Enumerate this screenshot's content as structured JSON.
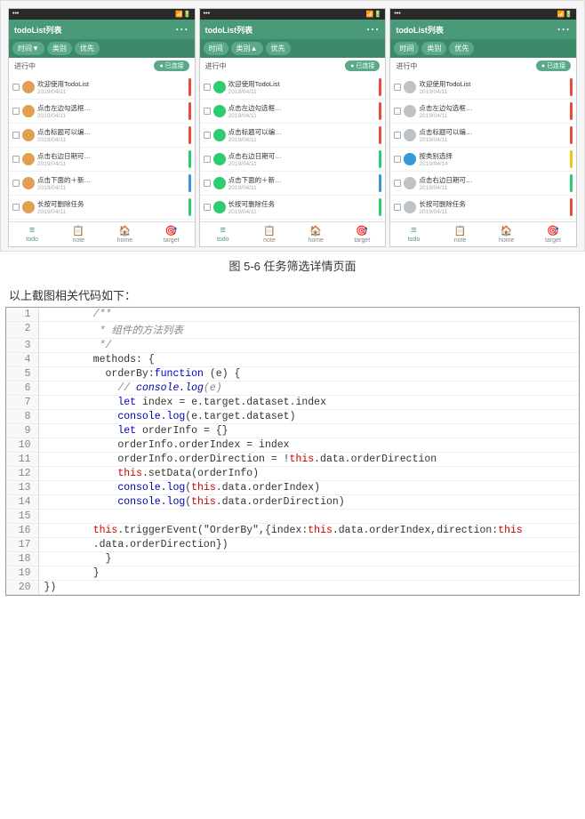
{
  "caption": "图 5-6  任务筛选详情页面",
  "codeIntro": "以上截图相关代码如下：",
  "screens": [
    {
      "titleBarText": "todoList列表",
      "statusInProgress": "进行中",
      "connectedBadge": "● 已连接",
      "filterBtns": [
        "时间▼",
        "类别",
        "优先"
      ],
      "items": [
        {
          "color": "#e0a050",
          "text": "欢迎使用TodoList",
          "date": "2019/04/11",
          "indicator": "#e74c3c"
        },
        {
          "color": "#e0a050",
          "text": "点击左边勾选框…",
          "date": "2019/04/11",
          "indicator": "#e74c3c"
        },
        {
          "color": "#e0a050",
          "text": "点击标题可以编…",
          "date": "2019/04/11",
          "indicator": "#e74c3c"
        },
        {
          "color": "#e0a050",
          "text": "点击右边日期可…",
          "date": "2019/04/11",
          "indicator": "#2ecc71"
        },
        {
          "color": "#e0a050",
          "text": "点击下面的＋新…",
          "date": "2019/04/11",
          "indicator": "#3498db"
        },
        {
          "color": "#e0a050",
          "text": "长按可删除任务",
          "date": "2019/04/11",
          "indicator": "#2ecc71"
        }
      ]
    },
    {
      "titleBarText": "todoList列表",
      "statusInProgress": "进行中",
      "connectedBadge": "● 已连接",
      "filterBtns": [
        "时间",
        "类别▲",
        "优先"
      ],
      "items": [
        {
          "color": "#2ecc71",
          "text": "欢迎使用TodoList",
          "date": "2019/04/11",
          "indicator": "#e74c3c"
        },
        {
          "color": "#2ecc71",
          "text": "点击左边勾选框…",
          "date": "2019/04/11",
          "indicator": "#e74c3c"
        },
        {
          "color": "#2ecc71",
          "text": "点击标题可以编…",
          "date": "2019/04/11",
          "indicator": "#e74c3c"
        },
        {
          "color": "#2ecc71",
          "text": "点击右边日期可…",
          "date": "2019/04/11",
          "indicator": "#2ecc71"
        },
        {
          "color": "#2ecc71",
          "text": "点击下面的＋新…",
          "date": "2019/04/11",
          "indicator": "#3498db"
        },
        {
          "color": "#2ecc71",
          "text": "长按可删除任务",
          "date": "2019/04/11",
          "indicator": "#2ecc71"
        }
      ]
    },
    {
      "titleBarText": "todoList列表",
      "statusInProgress": "进行中",
      "connectedBadge": "● 已连接",
      "filterBtns": [
        "时间",
        "类别",
        "优先"
      ],
      "items": [
        {
          "color": "#bdc3c7",
          "text": "欢迎使用TodoList",
          "date": "2019/04/11",
          "indicator": "#e74c3c"
        },
        {
          "color": "#bdc3c7",
          "text": "点击左边勾选框…",
          "date": "2019/04/11",
          "indicator": "#e74c3c"
        },
        {
          "color": "#bdc3c7",
          "text": "点击标题可以编…",
          "date": "2019/04/11",
          "indicator": "#e74c3c"
        },
        {
          "color": "#3498db",
          "text": "按类别选择",
          "date": "2019/04/14",
          "indicator": "#f1c40f"
        },
        {
          "color": "#bdc3c7",
          "text": "点击右边日期可…",
          "date": "2019/04/11",
          "indicator": "#2ecc71"
        },
        {
          "color": "#bdc3c7",
          "text": "长按可删除任务",
          "date": "2019/04/11",
          "indicator": "#e74c3c"
        }
      ]
    }
  ],
  "bottomNav": [
    {
      "icon": "≡",
      "label": "todo"
    },
    {
      "icon": "📋",
      "label": "note"
    },
    {
      "icon": "🏠",
      "label": "home"
    },
    {
      "icon": "🎯",
      "label": "target"
    }
  ],
  "code": {
    "lines": [
      {
        "num": 1,
        "content": "        /**"
      },
      {
        "num": 2,
        "content": "         * 组件的方法列表"
      },
      {
        "num": 3,
        "content": "         */"
      },
      {
        "num": 4,
        "content": "        methods: {"
      },
      {
        "num": 5,
        "content": "          orderBy:function (e) {"
      },
      {
        "num": 6,
        "content": "            // console.log(e)"
      },
      {
        "num": 7,
        "content": "            let index = e.target.dataset.index"
      },
      {
        "num": 8,
        "content": "            console.log(e.target.dataset)"
      },
      {
        "num": 9,
        "content": "            let orderInfo = {}"
      },
      {
        "num": 10,
        "content": "            orderInfo.orderIndex = index"
      },
      {
        "num": 11,
        "content": "            orderInfo.orderDirection = !this.data.orderDirection"
      },
      {
        "num": 12,
        "content": "            this.setData(orderInfo)"
      },
      {
        "num": 13,
        "content": "            console.log(this.data.orderIndex)"
      },
      {
        "num": 14,
        "content": "            console.log(this.data.orderDirection)"
      },
      {
        "num": 15,
        "content": ""
      },
      {
        "num": 16,
        "content": "        this.triggerEvent(\"OrderBy\",{index:this.data.orderIndex,direction:this"
      },
      {
        "num": 17,
        "content": "        .data.orderDirection})"
      },
      {
        "num": 18,
        "content": "          }"
      },
      {
        "num": 19,
        "content": "        }"
      },
      {
        "num": 20,
        "content": "})"
      }
    ]
  }
}
